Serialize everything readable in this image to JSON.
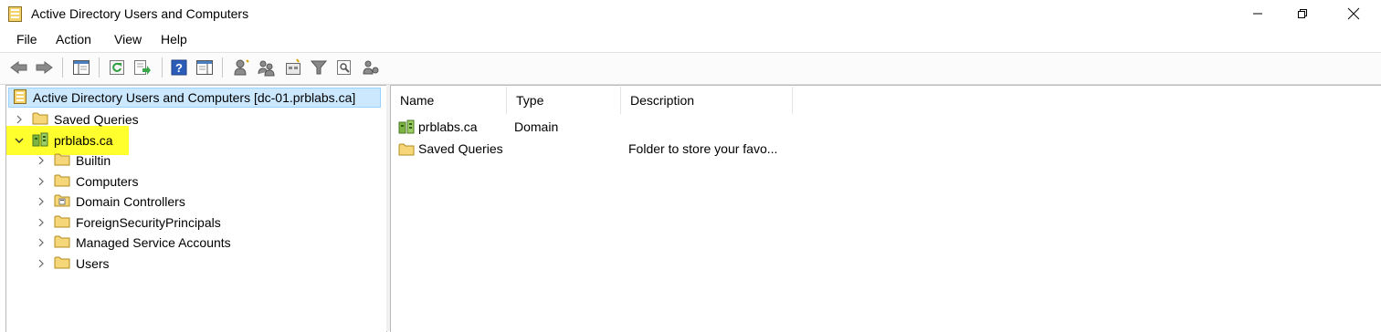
{
  "window": {
    "title": "Active Directory Users and Computers",
    "controls": {
      "minimize": "—",
      "restore": "❐",
      "close": "✕"
    }
  },
  "menu": [
    "File",
    "Action",
    "View",
    "Help"
  ],
  "toolbar": {
    "buttons": [
      "back-icon",
      "forward-icon",
      "show-hide-console-tree-icon",
      "refresh-icon",
      "export-list-icon",
      "help-icon",
      "show-hide-action-pane-icon",
      "create-user-icon",
      "create-group-icon",
      "create-ou-icon",
      "filter-icon",
      "find-icon",
      "add-to-group-icon"
    ]
  },
  "tree": {
    "root": "Active Directory Users and Computers [dc-01.prblabs.ca]",
    "saved_queries": "Saved Queries",
    "domain": "prblabs.ca",
    "children": [
      "Builtin",
      "Computers",
      "Domain Controllers",
      "ForeignSecurityPrincipals",
      "Managed Service Accounts",
      "Users"
    ]
  },
  "list": {
    "columns": {
      "name": "Name",
      "type": "Type",
      "description": "Description"
    },
    "rows": [
      {
        "name": "prblabs.ca",
        "type": "Domain",
        "description": "",
        "icon": "domain-icon"
      },
      {
        "name": "Saved Queries",
        "type": "",
        "description": "Folder to store your favo...",
        "icon": "folder-icon"
      }
    ]
  },
  "colors": {
    "selection": "#cce8ff",
    "highlight": "#ffff2e",
    "folder": "#f5d77a"
  }
}
